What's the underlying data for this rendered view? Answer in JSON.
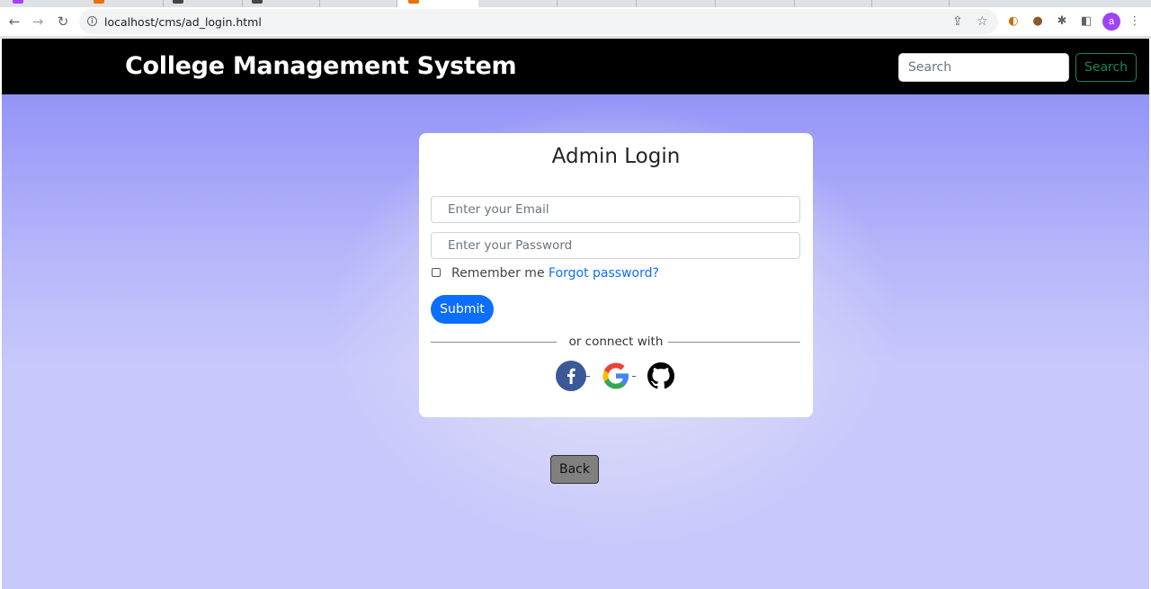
{
  "browser": {
    "url": "localhost/cms/ad_login.html"
  },
  "navbar": {
    "brand": "College Management System",
    "search_placeholder": "Search",
    "search_button": "Search"
  },
  "login": {
    "title": "Admin Login",
    "email_placeholder": "Enter your Email",
    "password_placeholder": "Enter your Password",
    "remember_label": "Remember me",
    "forgot_link": "Forgot password?",
    "submit_label": "Submit",
    "divider_text": "or connect with",
    "social_icons": [
      "facebook-icon",
      "google-icon",
      "github-icon"
    ]
  },
  "back_label": "Back",
  "colors": {
    "navbar_bg": "#000000",
    "primary": "#0d6efd",
    "success": "#198754",
    "page_bg": "#c8c8fc"
  }
}
